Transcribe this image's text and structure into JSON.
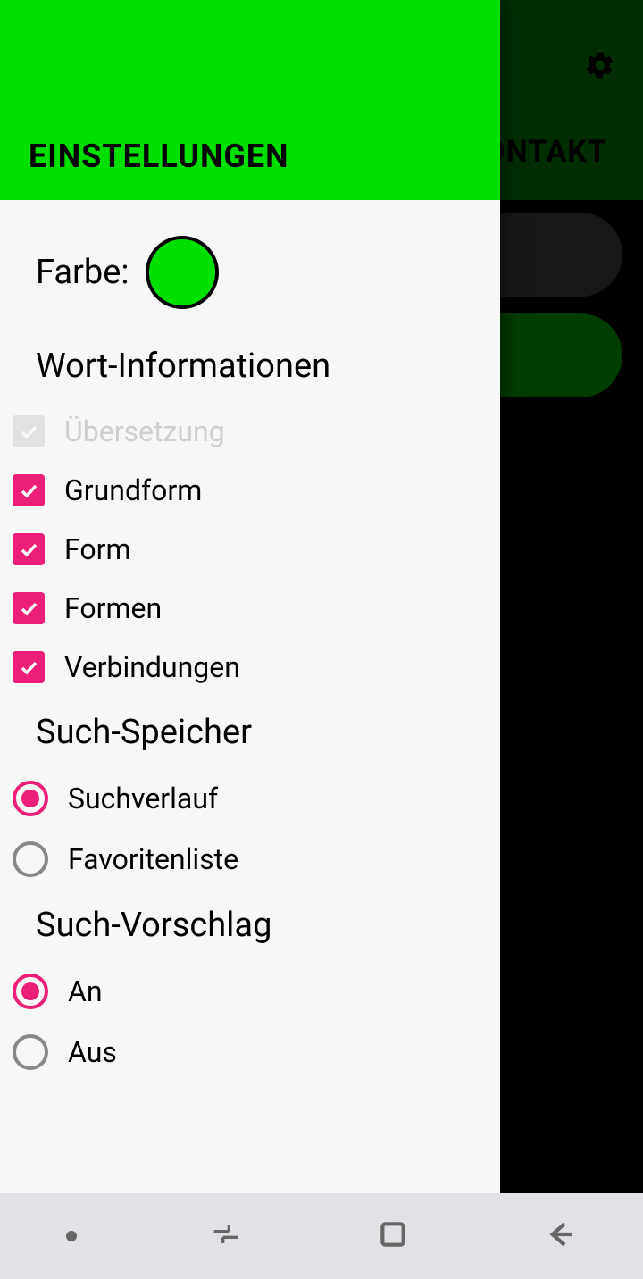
{
  "background": {
    "tab_label": "ONTAKT"
  },
  "drawer": {
    "title": "EINSTELLUNGEN",
    "color": {
      "label": "Farbe:",
      "value": "#00e000"
    },
    "sections": {
      "word_info": {
        "title": "Wort-Informationen",
        "items": [
          {
            "label": "Übersetzung",
            "checked": true,
            "disabled": true
          },
          {
            "label": "Grundform",
            "checked": true,
            "disabled": false
          },
          {
            "label": "Form",
            "checked": true,
            "disabled": false
          },
          {
            "label": "Formen",
            "checked": true,
            "disabled": false
          },
          {
            "label": "Verbindungen",
            "checked": true,
            "disabled": false
          }
        ]
      },
      "search_storage": {
        "title": "Such-Speicher",
        "items": [
          {
            "label": "Suchverlauf",
            "selected": true
          },
          {
            "label": "Favoritenliste",
            "selected": false
          }
        ]
      },
      "search_suggest": {
        "title": "Such-Vorschlag",
        "items": [
          {
            "label": "An",
            "selected": true
          },
          {
            "label": "Aus",
            "selected": false
          }
        ]
      }
    }
  }
}
